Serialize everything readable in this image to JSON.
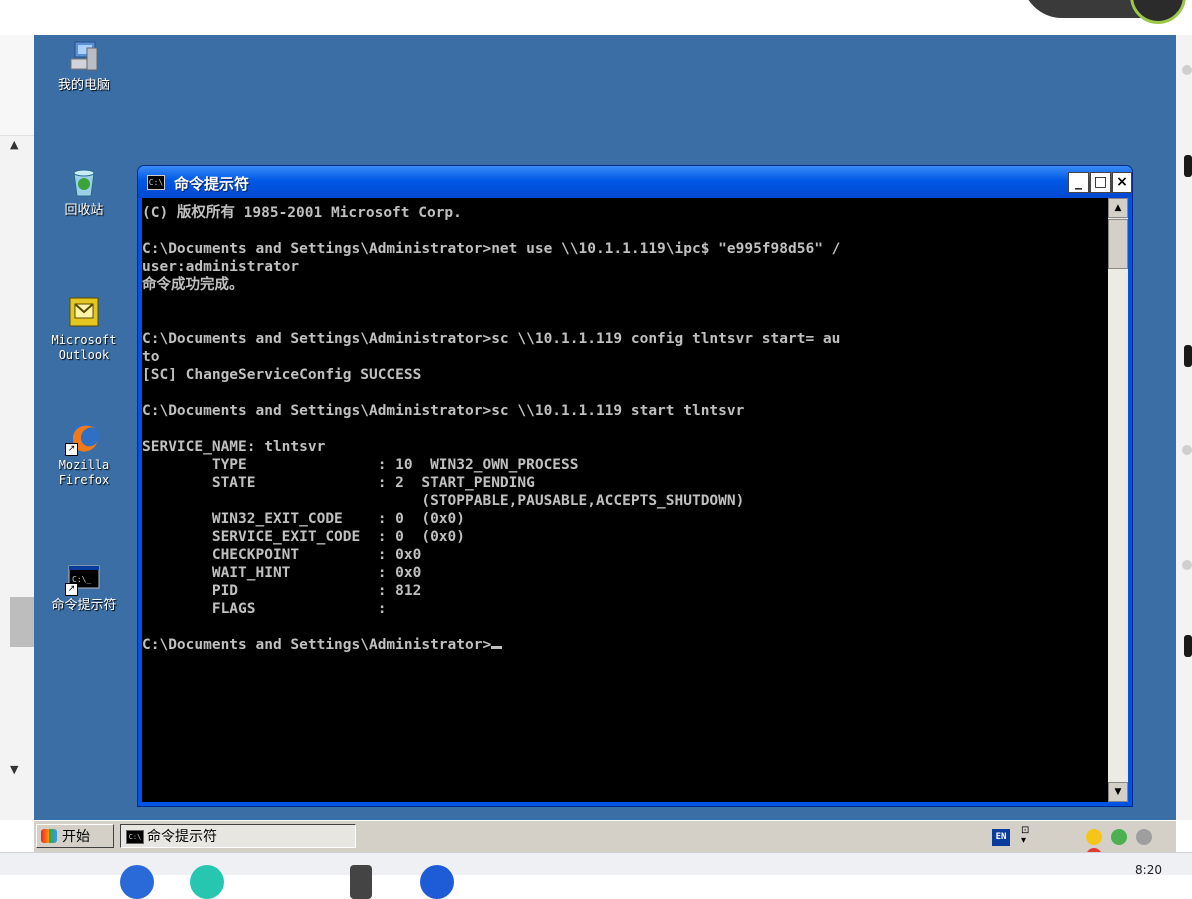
{
  "host": {
    "clock": "8:20"
  },
  "desktop": {
    "icons": [
      {
        "label": "我的电脑",
        "icon": "my-computer-icon"
      },
      {
        "label": "回收站",
        "icon": "recycle-bin-icon"
      },
      {
        "label": "Microsoft Outlook",
        "icon": "outlook-icon"
      },
      {
        "label": "Mozilla Firefox",
        "icon": "firefox-icon"
      },
      {
        "label": "命令提示符",
        "icon": "command-prompt-icon"
      }
    ]
  },
  "window": {
    "title": "命令提示符",
    "minimize_label": "_",
    "maximize_label": "□",
    "close_label": "×",
    "console_text": "(C) 版权所有 1985-2001 Microsoft Corp.\n\nC:\\Documents and Settings\\Administrator>net use \\\\10.1.1.119\\ipc$ \"e995f98d56\" /\nuser:administrator\n命令成功完成。\n\n\nC:\\Documents and Settings\\Administrator>sc \\\\10.1.1.119 config tlntsvr start= au\nto\n[SC] ChangeServiceConfig SUCCESS\n\nC:\\Documents and Settings\\Administrator>sc \\\\10.1.1.119 start tlntsvr\n\nSERVICE_NAME: tlntsvr\n        TYPE               : 10  WIN32_OWN_PROCESS\n        STATE              : 2  START_PENDING\n                                (STOPPABLE,PAUSABLE,ACCEPTS_SHUTDOWN)\n        WIN32_EXIT_CODE    : 0  (0x0)\n        SERVICE_EXIT_CODE  : 0  (0x0)\n        CHECKPOINT         : 0x0\n        WAIT_HINT          : 0x0\n        PID                : 812\n        FLAGS              :\n\nC:\\Documents and Settings\\Administrator>"
  },
  "taskbar": {
    "start_label": "开始",
    "task_label": "命令提示符",
    "language": "EN"
  }
}
